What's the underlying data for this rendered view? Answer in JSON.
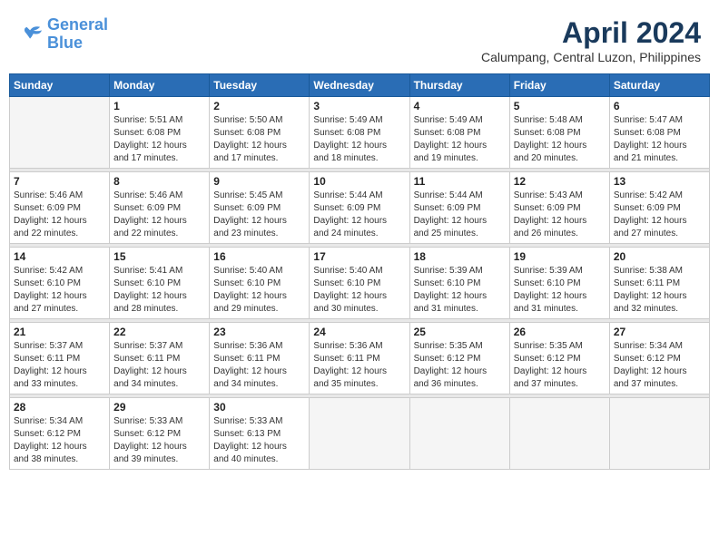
{
  "logo": {
    "line1": "General",
    "line2": "Blue"
  },
  "title": "April 2024",
  "subtitle": "Calumpang, Central Luzon, Philippines",
  "weekdays": [
    "Sunday",
    "Monday",
    "Tuesday",
    "Wednesday",
    "Thursday",
    "Friday",
    "Saturday"
  ],
  "weeks": [
    [
      {
        "day": "",
        "info": ""
      },
      {
        "day": "1",
        "info": "Sunrise: 5:51 AM\nSunset: 6:08 PM\nDaylight: 12 hours\nand 17 minutes."
      },
      {
        "day": "2",
        "info": "Sunrise: 5:50 AM\nSunset: 6:08 PM\nDaylight: 12 hours\nand 17 minutes."
      },
      {
        "day": "3",
        "info": "Sunrise: 5:49 AM\nSunset: 6:08 PM\nDaylight: 12 hours\nand 18 minutes."
      },
      {
        "day": "4",
        "info": "Sunrise: 5:49 AM\nSunset: 6:08 PM\nDaylight: 12 hours\nand 19 minutes."
      },
      {
        "day": "5",
        "info": "Sunrise: 5:48 AM\nSunset: 6:08 PM\nDaylight: 12 hours\nand 20 minutes."
      },
      {
        "day": "6",
        "info": "Sunrise: 5:47 AM\nSunset: 6:08 PM\nDaylight: 12 hours\nand 21 minutes."
      }
    ],
    [
      {
        "day": "7",
        "info": "Sunrise: 5:46 AM\nSunset: 6:09 PM\nDaylight: 12 hours\nand 22 minutes."
      },
      {
        "day": "8",
        "info": "Sunrise: 5:46 AM\nSunset: 6:09 PM\nDaylight: 12 hours\nand 22 minutes."
      },
      {
        "day": "9",
        "info": "Sunrise: 5:45 AM\nSunset: 6:09 PM\nDaylight: 12 hours\nand 23 minutes."
      },
      {
        "day": "10",
        "info": "Sunrise: 5:44 AM\nSunset: 6:09 PM\nDaylight: 12 hours\nand 24 minutes."
      },
      {
        "day": "11",
        "info": "Sunrise: 5:44 AM\nSunset: 6:09 PM\nDaylight: 12 hours\nand 25 minutes."
      },
      {
        "day": "12",
        "info": "Sunrise: 5:43 AM\nSunset: 6:09 PM\nDaylight: 12 hours\nand 26 minutes."
      },
      {
        "day": "13",
        "info": "Sunrise: 5:42 AM\nSunset: 6:09 PM\nDaylight: 12 hours\nand 27 minutes."
      }
    ],
    [
      {
        "day": "14",
        "info": "Sunrise: 5:42 AM\nSunset: 6:10 PM\nDaylight: 12 hours\nand 27 minutes."
      },
      {
        "day": "15",
        "info": "Sunrise: 5:41 AM\nSunset: 6:10 PM\nDaylight: 12 hours\nand 28 minutes."
      },
      {
        "day": "16",
        "info": "Sunrise: 5:40 AM\nSunset: 6:10 PM\nDaylight: 12 hours\nand 29 minutes."
      },
      {
        "day": "17",
        "info": "Sunrise: 5:40 AM\nSunset: 6:10 PM\nDaylight: 12 hours\nand 30 minutes."
      },
      {
        "day": "18",
        "info": "Sunrise: 5:39 AM\nSunset: 6:10 PM\nDaylight: 12 hours\nand 31 minutes."
      },
      {
        "day": "19",
        "info": "Sunrise: 5:39 AM\nSunset: 6:10 PM\nDaylight: 12 hours\nand 31 minutes."
      },
      {
        "day": "20",
        "info": "Sunrise: 5:38 AM\nSunset: 6:11 PM\nDaylight: 12 hours\nand 32 minutes."
      }
    ],
    [
      {
        "day": "21",
        "info": "Sunrise: 5:37 AM\nSunset: 6:11 PM\nDaylight: 12 hours\nand 33 minutes."
      },
      {
        "day": "22",
        "info": "Sunrise: 5:37 AM\nSunset: 6:11 PM\nDaylight: 12 hours\nand 34 minutes."
      },
      {
        "day": "23",
        "info": "Sunrise: 5:36 AM\nSunset: 6:11 PM\nDaylight: 12 hours\nand 34 minutes."
      },
      {
        "day": "24",
        "info": "Sunrise: 5:36 AM\nSunset: 6:11 PM\nDaylight: 12 hours\nand 35 minutes."
      },
      {
        "day": "25",
        "info": "Sunrise: 5:35 AM\nSunset: 6:12 PM\nDaylight: 12 hours\nand 36 minutes."
      },
      {
        "day": "26",
        "info": "Sunrise: 5:35 AM\nSunset: 6:12 PM\nDaylight: 12 hours\nand 37 minutes."
      },
      {
        "day": "27",
        "info": "Sunrise: 5:34 AM\nSunset: 6:12 PM\nDaylight: 12 hours\nand 37 minutes."
      }
    ],
    [
      {
        "day": "28",
        "info": "Sunrise: 5:34 AM\nSunset: 6:12 PM\nDaylight: 12 hours\nand 38 minutes."
      },
      {
        "day": "29",
        "info": "Sunrise: 5:33 AM\nSunset: 6:12 PM\nDaylight: 12 hours\nand 39 minutes."
      },
      {
        "day": "30",
        "info": "Sunrise: 5:33 AM\nSunset: 6:13 PM\nDaylight: 12 hours\nand 40 minutes."
      },
      {
        "day": "",
        "info": ""
      },
      {
        "day": "",
        "info": ""
      },
      {
        "day": "",
        "info": ""
      },
      {
        "day": "",
        "info": ""
      }
    ]
  ]
}
